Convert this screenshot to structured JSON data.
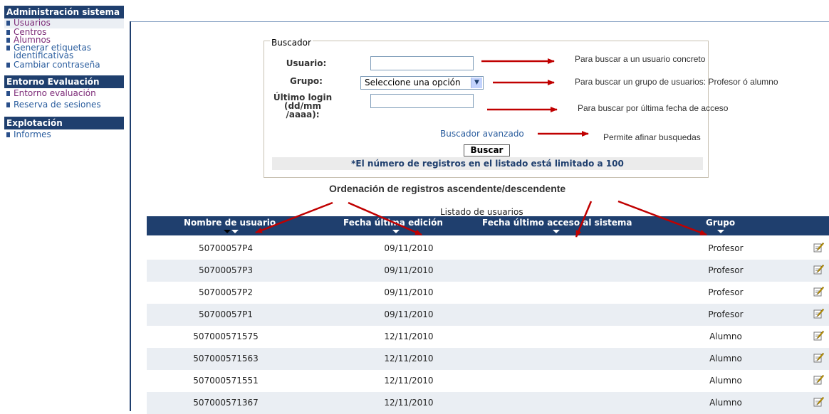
{
  "sidebar": {
    "sections": [
      {
        "title": "Administración sistema"
      },
      {
        "title": "Entorno Evaluación"
      },
      {
        "title": "Explotación"
      }
    ],
    "admin_items": [
      "Usuarios",
      "Centros",
      "Alumnos",
      "Generar etiquetas",
      "identificativas",
      "Cambiar contraseña"
    ],
    "entorno_items": [
      "Entorno evaluación",
      "Reserva de sesiones"
    ],
    "explot_items": [
      "Informes"
    ]
  },
  "search": {
    "legend": "Buscador",
    "usuario_label": "Usuario:",
    "usuario_value": "",
    "grupo_label": "Grupo:",
    "grupo_selected": "Seleccione una opción",
    "login_label_1": "Último login",
    "login_label_2": "(dd/mm",
    "login_label_3": "/aaaa):",
    "login_value": "",
    "advanced_link": "Buscador avanzado",
    "button": "Buscar",
    "limit_note": "*El número de registros en el listado está limitado a 100"
  },
  "annotations": {
    "usuario_note": "Para buscar a un usuario concreto",
    "grupo_note": "Para buscar un grupo de usuarios: Profesor ó alumno",
    "login_note": "Para buscar por última fecha de acceso",
    "advanced_note": "Permite afinar busquedas",
    "order_title": "Ordenación de registros ascendente/descendente",
    "arrow_color": "#c00000"
  },
  "table": {
    "caption": "Listado de usuarios",
    "columns": [
      "Nombre de usuario",
      "Fecha última edición",
      "Fecha último acceso al sistema",
      "Grupo"
    ],
    "rows": [
      {
        "user": "50700057P4",
        "date": "09/11/2010",
        "group": "Profesor"
      },
      {
        "user": "50700057P3",
        "date": "09/11/2010",
        "group": "Profesor"
      },
      {
        "user": "50700057P2",
        "date": "09/11/2010",
        "group": "Profesor"
      },
      {
        "user": "50700057P1",
        "date": "09/11/2010",
        "group": "Profesor"
      },
      {
        "user": "507000571575",
        "date": "12/11/2010",
        "group": "Alumno"
      },
      {
        "user": "507000571563",
        "date": "12/11/2010",
        "group": "Alumno"
      },
      {
        "user": "507000571551",
        "date": "12/11/2010",
        "group": "Alumno"
      },
      {
        "user": "507000571367",
        "date": "12/11/2010",
        "group": "Alumno"
      }
    ],
    "edit_icon": "edit-pencil-icon"
  },
  "colors": {
    "header_blue": "#1f3f6e",
    "link_blue": "#2a5d9e",
    "visited_purple": "#7d2b78",
    "alt_row": "#eaeef3"
  }
}
